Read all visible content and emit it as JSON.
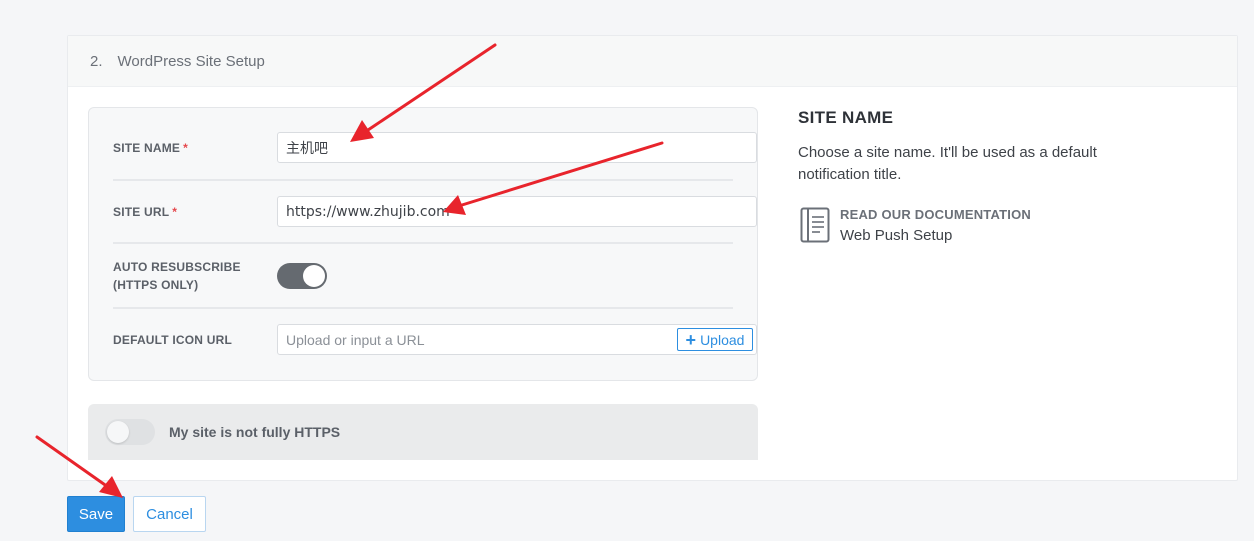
{
  "section": {
    "number": "2.",
    "title": "WordPress Site Setup"
  },
  "form": {
    "site_name": {
      "label": "SITE NAME",
      "required_mark": "*",
      "value": "主机吧"
    },
    "site_url": {
      "label": "SITE URL",
      "required_mark": "*",
      "value": "https://www.zhujib.com"
    },
    "auto_resubscribe": {
      "label_line1": "AUTO RESUBSCRIBE",
      "label_line2": "(HTTPS ONLY)",
      "enabled": true
    },
    "default_icon": {
      "label": "DEFAULT ICON URL",
      "placeholder": "Upload or input a URL",
      "upload_label": "Upload"
    }
  },
  "https_toggle": {
    "label": "My site is not fully HTTPS",
    "enabled": false
  },
  "help": {
    "title": "SITE NAME",
    "description": "Choose a site name. It'll be used as a default notification title.",
    "doc_kicker": "READ OUR DOCUMENTATION",
    "doc_link": "Web Push Setup",
    "doc_icon": "document-icon"
  },
  "actions": {
    "save_label": "Save",
    "cancel_label": "Cancel"
  },
  "colors": {
    "accent": "#2d8ee0",
    "arrow": "#e8242c",
    "required": "#e5484d"
  }
}
